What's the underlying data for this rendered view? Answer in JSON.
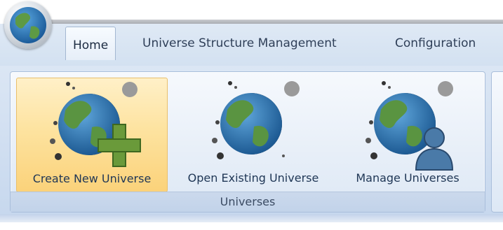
{
  "tabs": [
    {
      "label": "Home",
      "active": true
    },
    {
      "label": "Universe Structure Management",
      "active": false
    },
    {
      "label": "Configuration",
      "active": false
    }
  ],
  "ribbon": {
    "group_label": "Universes",
    "buttons": [
      {
        "label": "Create New Universe",
        "icon": "globe-plus-icon",
        "active": true
      },
      {
        "label": "Open Existing Universe",
        "icon": "globe-icon",
        "active": false
      },
      {
        "label": "Manage Universes",
        "icon": "globe-user-icon",
        "active": false
      }
    ]
  },
  "colors": {
    "ribbon_bg": "#dbe6f4",
    "active_button": "#fde3a0",
    "text": "#1f3655"
  }
}
